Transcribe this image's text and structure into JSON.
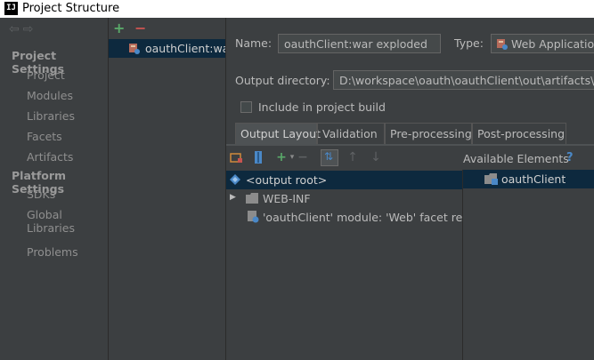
{
  "window": {
    "title": "Project Structure",
    "app_icon": "intellij-icon"
  },
  "nav": {
    "back_icon": "back-arrow-icon",
    "forward_icon": "forward-arrow-icon",
    "project_settings": {
      "heading": "Project Settings",
      "items": [
        "Project",
        "Modules",
        "Libraries",
        "Facets",
        "Artifacts"
      ]
    },
    "platform_settings": {
      "heading": "Platform Settings",
      "items": [
        "SDKs",
        "Global Libraries"
      ]
    },
    "problems": "Problems"
  },
  "artifacts": {
    "add_icon": "+",
    "remove_icon": "−",
    "items": [
      {
        "label": "oauthClient:war",
        "icon": "web-war-icon",
        "selected": true
      }
    ]
  },
  "detail": {
    "name_label": "Name:",
    "name_value": "oauthClient:war exploded",
    "type_label": "Type:",
    "type_value": "Web Application: Exploded",
    "output_dir_label": "Output directory:",
    "output_dir_value": "D:\\workspace\\oauth\\oauthClient\\out\\artifacts\\oauthClient_war_exploded",
    "include_in_build_label": "Include in project build",
    "include_in_build_checked": false
  },
  "tabs": [
    {
      "label": "Output Layout",
      "active": true
    },
    {
      "label": "Validation",
      "active": false
    },
    {
      "label": "Pre-processing",
      "active": false
    },
    {
      "label": "Post-processing",
      "active": false
    }
  ],
  "layout": {
    "available_elements_label": "Available Elements",
    "help_label": "?",
    "tree": [
      {
        "label": "<output root>",
        "icon": "output-root-icon",
        "selected": true,
        "indent": 0
      },
      {
        "label": "WEB-INF",
        "icon": "folder-icon",
        "expandable": true,
        "indent": 1
      },
      {
        "label": "'oauthClient' module: 'Web' facet resources",
        "icon": "web-facet-icon",
        "indent": 1
      }
    ],
    "available": [
      {
        "label": "oauthClient",
        "icon": "module-folder-icon"
      }
    ]
  },
  "colors": {
    "background": "#3c3f41",
    "selection": "#0d293e",
    "add_green": "#59a869",
    "remove_red": "#c75450",
    "help_blue": "#4a88c7"
  }
}
